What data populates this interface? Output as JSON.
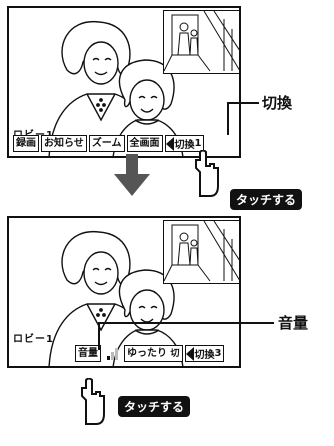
{
  "top_screen": {
    "room_label": "ロビー1",
    "buttons": [
      "録画",
      "お知らせ",
      "ズーム",
      "全画面"
    ],
    "switch_label": "切換",
    "switch_number": "1"
  },
  "bottom_screen": {
    "room_label": "ロビー1",
    "volume_label": "音量",
    "volume_level": 0.33,
    "slow_label": "ゆったり",
    "slow_state": "切",
    "switch_label": "切換",
    "switch_number": "3"
  },
  "callouts": {
    "switch": "切換",
    "volume": "音量"
  },
  "badges": {
    "top": "タッチする",
    "bottom": "タッチする"
  }
}
